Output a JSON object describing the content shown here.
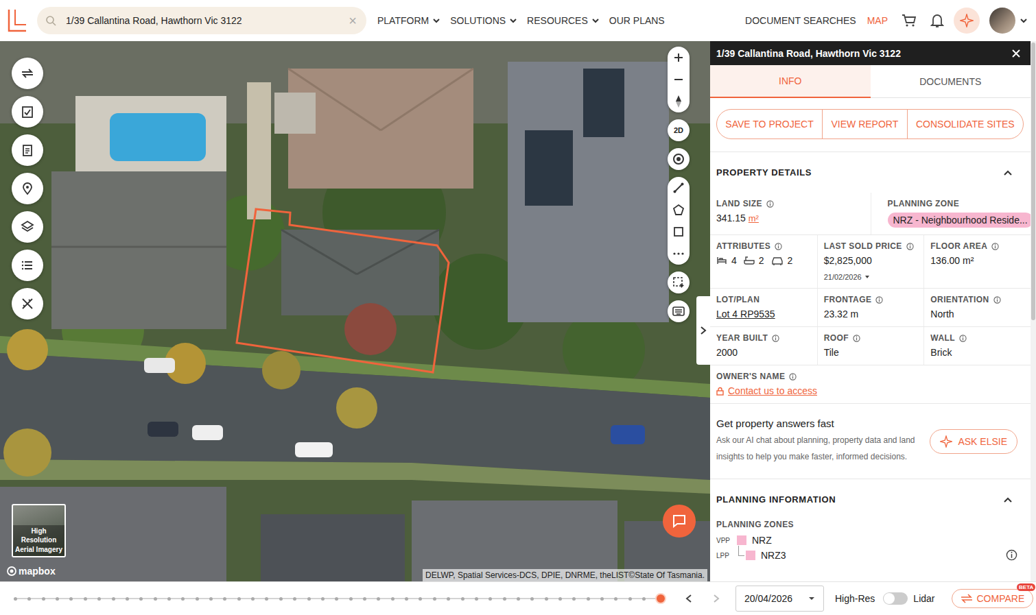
{
  "topbar": {
    "search": {
      "value": "1/39 Callantina Road, Hawthorn Vic 3122",
      "clear": "×"
    },
    "nav": [
      {
        "label": "PLATFORM",
        "dropdown": true
      },
      {
        "label": "SOLUTIONS",
        "dropdown": true
      },
      {
        "label": "RESOURCES",
        "dropdown": true
      },
      {
        "label": "OUR PLANS",
        "dropdown": false
      }
    ],
    "links": [
      {
        "label": "DOCUMENT SEARCHES",
        "selected": false
      },
      {
        "label": "MAP",
        "selected": true
      }
    ]
  },
  "map": {
    "view_mode": "2D",
    "thumbnail": "High Resolution Aerial Imagery",
    "logo": "mapbox",
    "attribution": "DELWP, Spatial Services-DCS, DPIE, DNRME, theLIST©State Of Tasmania."
  },
  "panel": {
    "title": "1/39 Callantina Road, Hawthorn Vic 3122",
    "tabs": [
      {
        "label": "INFO",
        "selected": true
      },
      {
        "label": "DOCUMENTS",
        "selected": false
      }
    ],
    "actions": [
      "SAVE TO PROJECT",
      "VIEW REPORT",
      "CONSOLIDATE SITES"
    ],
    "property_details": {
      "title": "PROPERTY DETAILS",
      "expanded": true,
      "rows": [
        [
          {
            "kind": "area",
            "label": "LAND SIZE",
            "info": true,
            "value": "341.15",
            "unit": "m²"
          },
          {
            "kind": "badge",
            "label": "PLANNING ZONE",
            "info": false,
            "value": "NRZ - Neighbourhood Reside..."
          }
        ],
        [
          {
            "kind": "attributes",
            "label": "ATTRIBUTES",
            "info": true,
            "items": [
              {
                "kind": "bed",
                "value": "4"
              },
              {
                "kind": "bath",
                "value": "2"
              },
              {
                "kind": "car",
                "value": "2"
              }
            ]
          },
          {
            "kind": "price",
            "label": "LAST SOLD PRICE",
            "info": true,
            "value": "$2,825,000",
            "date": "21/02/2026"
          },
          {
            "kind": "text",
            "label": "FLOOR AREA",
            "info": true,
            "value": "136.00 m²"
          }
        ],
        [
          {
            "kind": "link",
            "label": "LOT/PLAN",
            "info": false,
            "value": "Lot 4 RP9535"
          },
          {
            "kind": "text",
            "label": "FRONTAGE",
            "info": true,
            "value": "23.32 m"
          },
          {
            "kind": "text",
            "label": "ORIENTATION",
            "info": true,
            "value": "North"
          }
        ],
        [
          {
            "kind": "text",
            "label": "YEAR BUILT",
            "info": true,
            "value": "2000"
          },
          {
            "kind": "text",
            "label": "ROOF",
            "info": true,
            "value": "Tile"
          },
          {
            "kind": "text",
            "label": "WALL",
            "info": true,
            "value": "Brick"
          }
        ],
        [
          {
            "kind": "locked",
            "label": "OWNER'S NAME",
            "info": true,
            "value": "Contact us to access"
          }
        ]
      ]
    },
    "ask": {
      "title": "Get property answers fast",
      "text": "Ask our AI chat about planning, property data and land insights to help you make faster, informed decisions.",
      "button": "ASK ELSIE"
    },
    "planning": {
      "title": "PLANNING INFORMATION",
      "expanded": true,
      "zones_title": "PLANNING ZONES",
      "zones": [
        {
          "scheme": "VPP",
          "name": "NRZ"
        },
        {
          "scheme": "LPP",
          "name": "NRZ3"
        }
      ]
    }
  },
  "timeline": {
    "level": 1,
    "prev_disabled": false,
    "next_disabled": true,
    "date": "20/04/2026",
    "high_res": {
      "label": "High-Res",
      "on": false
    },
    "lidar": "Lidar",
    "compare": {
      "label": "COMPARE",
      "badge": "BETA"
    }
  }
}
